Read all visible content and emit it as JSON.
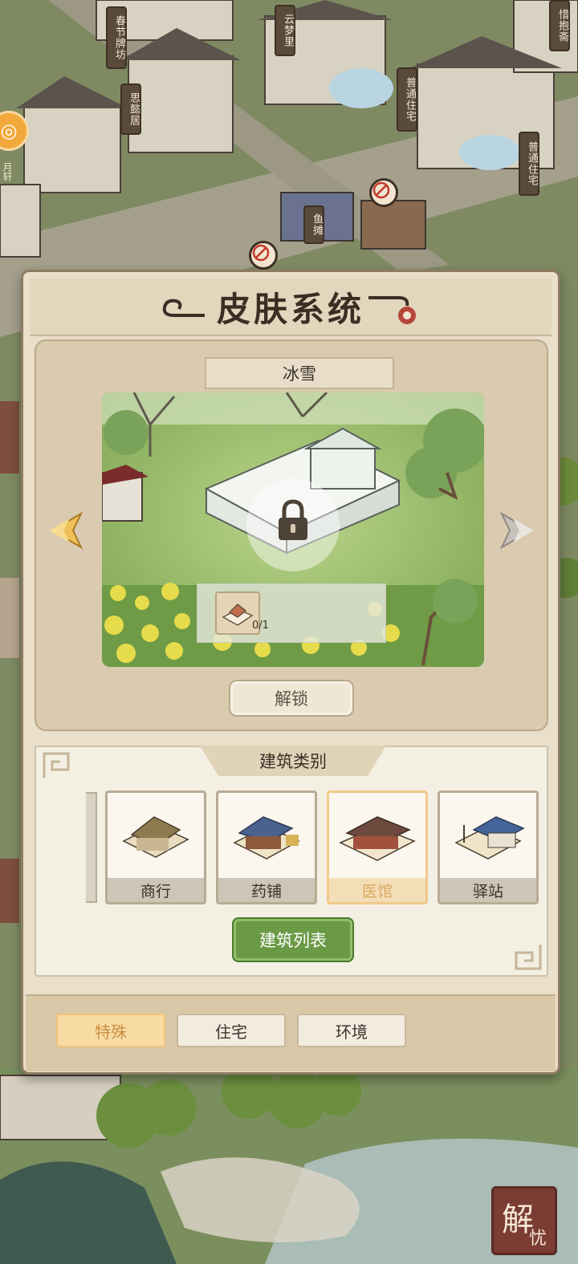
{
  "scene": {
    "signs": [
      {
        "text": "春节牌坊"
      },
      {
        "text": "思懿居"
      },
      {
        "text": "云梦里"
      },
      {
        "text": "普通住宅"
      },
      {
        "text": "惜抱斋"
      },
      {
        "text": "普通住宅"
      },
      {
        "text": "鱼摊"
      }
    ],
    "left_badge_caption": "月轩",
    "seal_text": [
      "解",
      "忧"
    ]
  },
  "panel": {
    "title": "皮肤系统",
    "skin_name": "冰雪",
    "cost_count": "0/1",
    "unlock_label": "解锁",
    "category_title": "建筑类别",
    "categories": [
      {
        "label": "商行",
        "selected": false
      },
      {
        "label": "药铺",
        "selected": false
      },
      {
        "label": "医馆",
        "selected": true
      },
      {
        "label": "驿站",
        "selected": false
      }
    ],
    "building_list_label": "建筑列表",
    "tabs": [
      {
        "label": "特殊",
        "active": true
      },
      {
        "label": "住宅",
        "active": false
      },
      {
        "label": "环境",
        "active": false
      }
    ]
  },
  "colors": {
    "panel_bg": "#e9dfcb",
    "accent_gold": "#f0c989",
    "green_button": "#6b9a47",
    "seal_red": "#7a3c33"
  }
}
